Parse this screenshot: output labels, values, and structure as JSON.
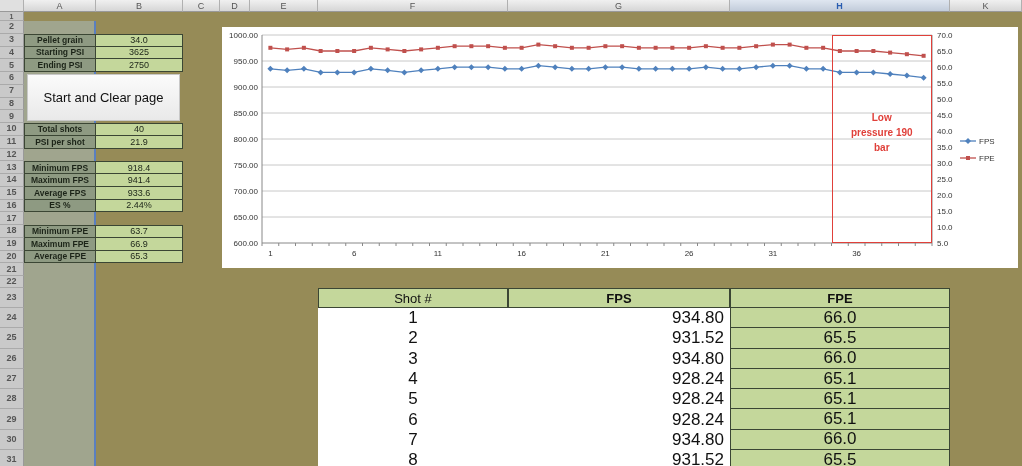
{
  "column_headers": [
    {
      "label": "A",
      "selected": false
    },
    {
      "label": "B",
      "selected": false
    },
    {
      "label": "C",
      "selected": false
    },
    {
      "label": "D",
      "selected": false
    },
    {
      "label": "E",
      "selected": false
    },
    {
      "label": "F",
      "selected": false
    },
    {
      "label": "G",
      "selected": false
    },
    {
      "label": "H",
      "selected": true
    },
    {
      "label": "K",
      "selected": false
    }
  ],
  "row_numbers": [
    "1",
    "2",
    "3",
    "4",
    "5",
    "6",
    "7",
    "8",
    "9",
    "10",
    "11",
    "12",
    "13",
    "14",
    "15",
    "16",
    "17",
    "18",
    "19",
    "20",
    "21",
    "22",
    "23",
    "24",
    "25",
    "26",
    "27",
    "28",
    "29",
    "30",
    "31"
  ],
  "stats_groups": [
    [
      {
        "label": "Pellet grain",
        "value": "34.0"
      },
      {
        "label": "Starting PSI",
        "value": "3625"
      },
      {
        "label": "Ending PSI",
        "value": "2750"
      }
    ],
    [
      {
        "label": "Total shots",
        "value": "40"
      },
      {
        "label": "PSI per shot",
        "value": "21.9"
      }
    ],
    [
      {
        "label": "Minimum FPS",
        "value": "918.4"
      },
      {
        "label": "Maximum FPS",
        "value": "941.4"
      },
      {
        "label": "Average FPS",
        "value": "933.6"
      },
      {
        "label": "ES %",
        "value": "2.44%"
      }
    ],
    [
      {
        "label": "Minimum FPE",
        "value": "63.7"
      },
      {
        "label": "Maximum FPE",
        "value": "66.9"
      },
      {
        "label": "Average FPE",
        "value": "65.3"
      }
    ]
  ],
  "clear_button": {
    "label": "Start and Clear page"
  },
  "chart": {
    "chart_data": {
      "type": "line",
      "xlim": [
        0.5,
        40.5
      ],
      "x": [
        1,
        2,
        3,
        4,
        5,
        6,
        7,
        8,
        9,
        10,
        11,
        12,
        13,
        14,
        15,
        16,
        17,
        18,
        19,
        20,
        21,
        22,
        23,
        24,
        25,
        26,
        27,
        28,
        29,
        30,
        31,
        32,
        33,
        34,
        35,
        36,
        37,
        38,
        39,
        40
      ],
      "series": [
        {
          "name": "FPS",
          "color": "#4f81bd",
          "marker": "diamond",
          "values": [
            935,
            932,
            935,
            928,
            928,
            928,
            935,
            932,
            928,
            932,
            935,
            938,
            938,
            938,
            935,
            935,
            941,
            938,
            935,
            935,
            938,
            938,
            935,
            935,
            935,
            935,
            938,
            935,
            935,
            938,
            941,
            941,
            935,
            935,
            928,
            928,
            928,
            925,
            922,
            918
          ]
        },
        {
          "name": "FPE",
          "color": "#c0504d",
          "axis": "y2",
          "marker": "square",
          "values": [
            66,
            65.5,
            66,
            65,
            65,
            65,
            66,
            65.5,
            65,
            65.5,
            66,
            66.5,
            66.5,
            66.5,
            66,
            66,
            67,
            66.5,
            66,
            66,
            66.5,
            66.5,
            66,
            66,
            66,
            66,
            66.5,
            66,
            66,
            66.5,
            67,
            67,
            66,
            66,
            65,
            65,
            65,
            64.5,
            64,
            63.5
          ]
        }
      ],
      "xticks": [
        {
          "value": 1,
          "label": "1"
        },
        {
          "value": 6,
          "label": "6"
        },
        {
          "value": 11,
          "label": "11"
        },
        {
          "value": 16,
          "label": "16"
        },
        {
          "value": 21,
          "label": "21"
        },
        {
          "value": 26,
          "label": "26"
        },
        {
          "value": 31,
          "label": "31"
        },
        {
          "value": 36,
          "label": "36"
        }
      ],
      "ylim": [
        600,
        1000
      ],
      "yticks": [
        {
          "value": 600,
          "label": "600.00"
        },
        {
          "value": 650,
          "label": "650.00"
        },
        {
          "value": 700,
          "label": "700.00"
        },
        {
          "value": 750,
          "label": "750.00"
        },
        {
          "value": 800,
          "label": "800.00"
        },
        {
          "value": 850,
          "label": "850.00"
        },
        {
          "value": 900,
          "label": "900.00"
        },
        {
          "value": 950,
          "label": "950.00"
        },
        {
          "value": 1000,
          "label": "1000.00"
        }
      ],
      "y2lim": [
        5,
        70
      ],
      "y2ticks": [
        {
          "value": 5,
          "label": "5.0"
        },
        {
          "value": 10,
          "label": "10.0"
        },
        {
          "value": 15,
          "label": "15.0"
        },
        {
          "value": 20,
          "label": "20.0"
        },
        {
          "value": 25,
          "label": "25.0"
        },
        {
          "value": 30,
          "label": "30.0"
        },
        {
          "value": 35,
          "label": "35.0"
        },
        {
          "value": 40,
          "label": "40.0"
        },
        {
          "value": 45,
          "label": "45.0"
        },
        {
          "value": 50,
          "label": "50.0"
        },
        {
          "value": 55,
          "label": "55.0"
        },
        {
          "value": 60,
          "label": "60.0"
        },
        {
          "value": 65,
          "label": "65.0"
        },
        {
          "value": 70,
          "label": "70.0"
        }
      ],
      "grid": true,
      "legend": true,
      "annotations": [
        "Low pressure 190 bar"
      ]
    }
  },
  "shots_table": {
    "columns": [
      "Shot #",
      "FPS",
      "FPE"
    ],
    "rows": [
      [
        "1",
        "934.80",
        "66.0"
      ],
      [
        "2",
        "931.52",
        "65.5"
      ],
      [
        "3",
        "934.80",
        "66.0"
      ],
      [
        "4",
        "928.24",
        "65.1"
      ],
      [
        "5",
        "928.24",
        "65.1"
      ],
      [
        "6",
        "928.24",
        "65.1"
      ],
      [
        "7",
        "934.80",
        "66.0"
      ],
      [
        "8",
        "931.52",
        "65.5"
      ]
    ]
  }
}
